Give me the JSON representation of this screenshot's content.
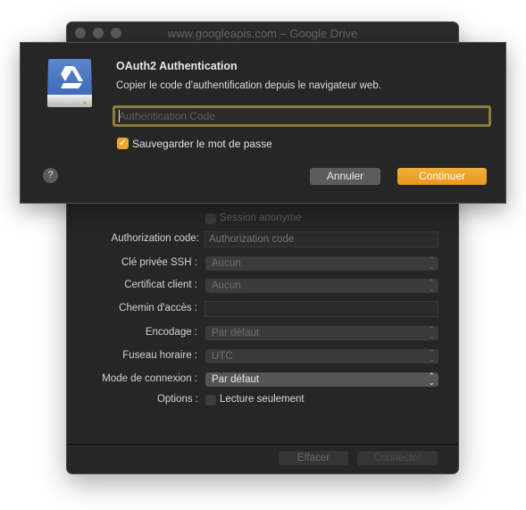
{
  "window": {
    "title": "www.googleapis.com – Google Drive",
    "traffic_lights": [
      "close",
      "minimize",
      "zoom"
    ]
  },
  "form": {
    "anonymous_session": {
      "label": "Session anonyme",
      "checked": false
    },
    "authorization_code": {
      "label": "Authorization code:",
      "placeholder": "Authorization code",
      "value": ""
    },
    "ssh_key": {
      "label": "Clé privée SSH :",
      "value": "Aucun"
    },
    "client_cert": {
      "label": "Certificat client :",
      "value": "Aucun"
    },
    "path": {
      "label": "Chemin d'accès :",
      "value": ""
    },
    "encoding": {
      "label": "Encodage :",
      "value": "Par défaut"
    },
    "timezone": {
      "label": "Fuseau horaire :",
      "value": "UTC"
    },
    "connect_mode": {
      "label": "Mode de connexion :",
      "value": "Par défaut"
    },
    "options": {
      "label": "Options :",
      "read_only_label": "Lecture seulement",
      "read_only_checked": false
    }
  },
  "footer": {
    "clear_label": "Effacer",
    "connect_label": "Connecter"
  },
  "sheet": {
    "icon": "google-drive-disk-icon",
    "title": "OAuth2 Authentication",
    "message": "Copier le code d'authentification depuis le navigateur web.",
    "code_input": {
      "placeholder": "Authentication Code",
      "value": ""
    },
    "save_password": {
      "label": "Sauvegarder le mot de passe",
      "checked": true
    },
    "help_label": "?",
    "cancel_label": "Annuler",
    "continue_label": "Continuer",
    "accent_color": "#f0a42a"
  }
}
